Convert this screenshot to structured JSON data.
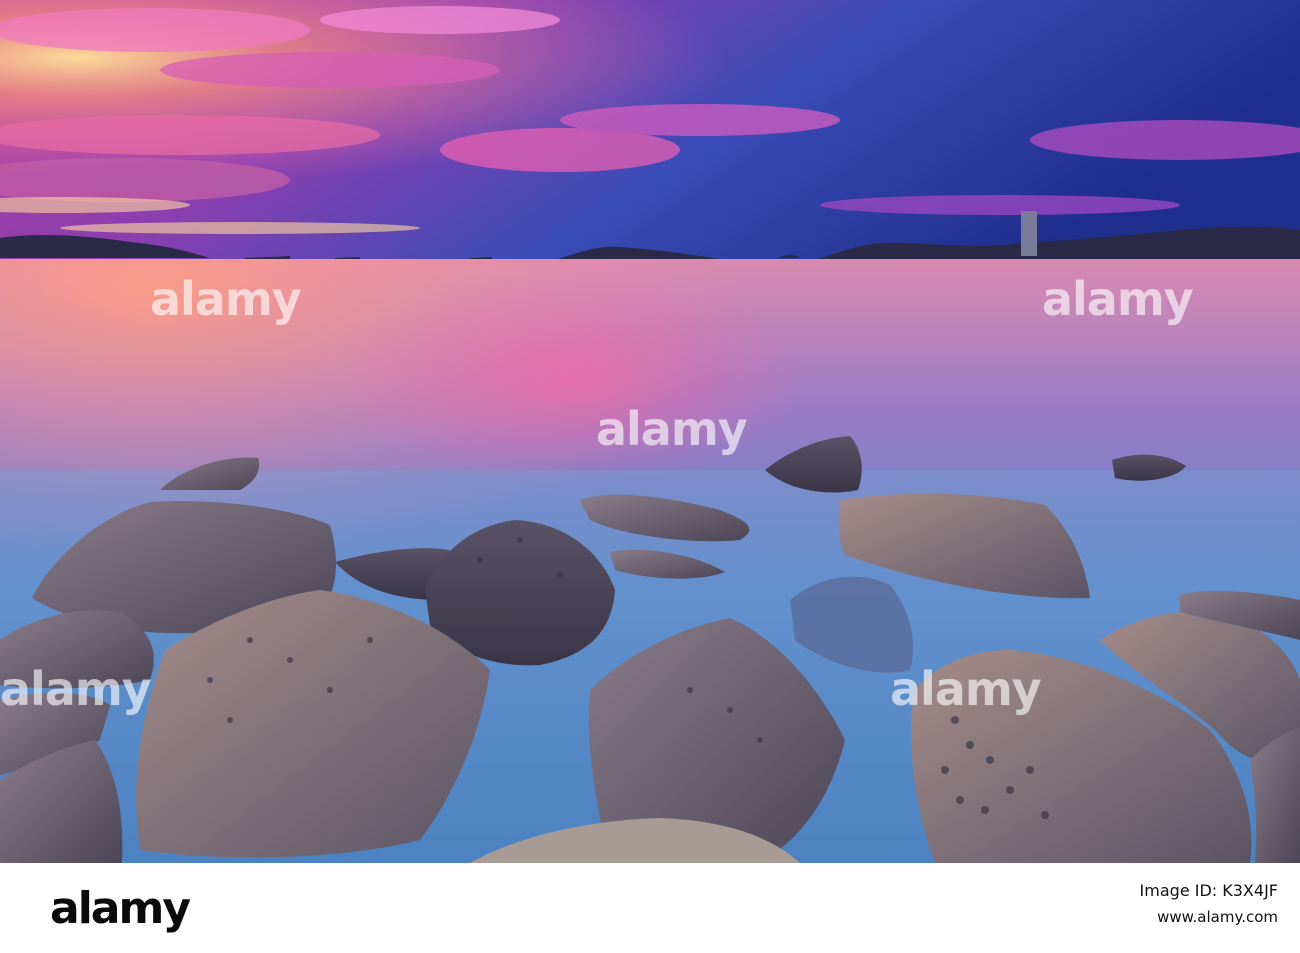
{
  "watermark": {
    "text": "alamy",
    "color": "#ffffff"
  },
  "footer": {
    "logo": "alamy",
    "image_id_label": "Image ID: K3X4JF",
    "url": "www.alamy.com"
  },
  "colors": {
    "sky_top": "#2e3aa0",
    "sky_pink": "#e04a9c",
    "horizon_glow": "#ffb86a",
    "water": "#4f7fc4",
    "rock": "#6f6678"
  }
}
